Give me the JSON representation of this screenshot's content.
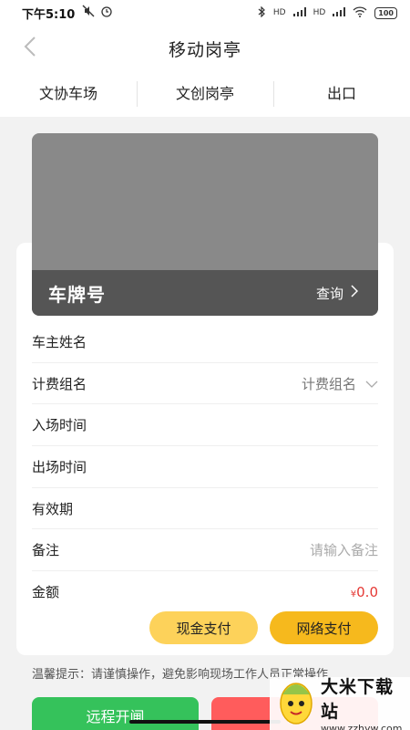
{
  "status_bar": {
    "time": "下午5:10",
    "battery": "100",
    "signal_labels": [
      "HD",
      "HD"
    ]
  },
  "nav": {
    "title": "移动岗亭",
    "back_icon": "chevron-left-icon"
  },
  "tabs": [
    {
      "label": "文协车场"
    },
    {
      "label": "文创岗亭"
    },
    {
      "label": "出口"
    }
  ],
  "camera": {
    "plate_label": "车牌号",
    "query_label": "查询"
  },
  "fields": {
    "owner_name": {
      "label": "车主姓名"
    },
    "billing_group": {
      "label": "计费组名",
      "value": "计费组名"
    },
    "entry_time": {
      "label": "入场时间"
    },
    "exit_time": {
      "label": "出场时间"
    },
    "validity": {
      "label": "有效期"
    },
    "remark": {
      "label": "备注",
      "placeholder": "请输入备注"
    },
    "amount": {
      "label": "金额",
      "currency": "¥",
      "value": "0.0"
    }
  },
  "pay": {
    "cash_label": "现金支付",
    "online_label": "网络支付"
  },
  "tip": "温馨提示：请谨慎操作，避免影响现场工作人员正常操作",
  "bottom": {
    "remote_open_label": "远程开闸",
    "remote_close_label": "远"
  },
  "watermark": {
    "title": "大米下载站",
    "url": "www.zzhyw.com"
  },
  "colors": {
    "pay_cash": "#fdd25a",
    "pay_online": "#f6b91d",
    "btn_green": "#35c25b",
    "btn_red": "#ff5c5c",
    "amount": "#e53935"
  }
}
